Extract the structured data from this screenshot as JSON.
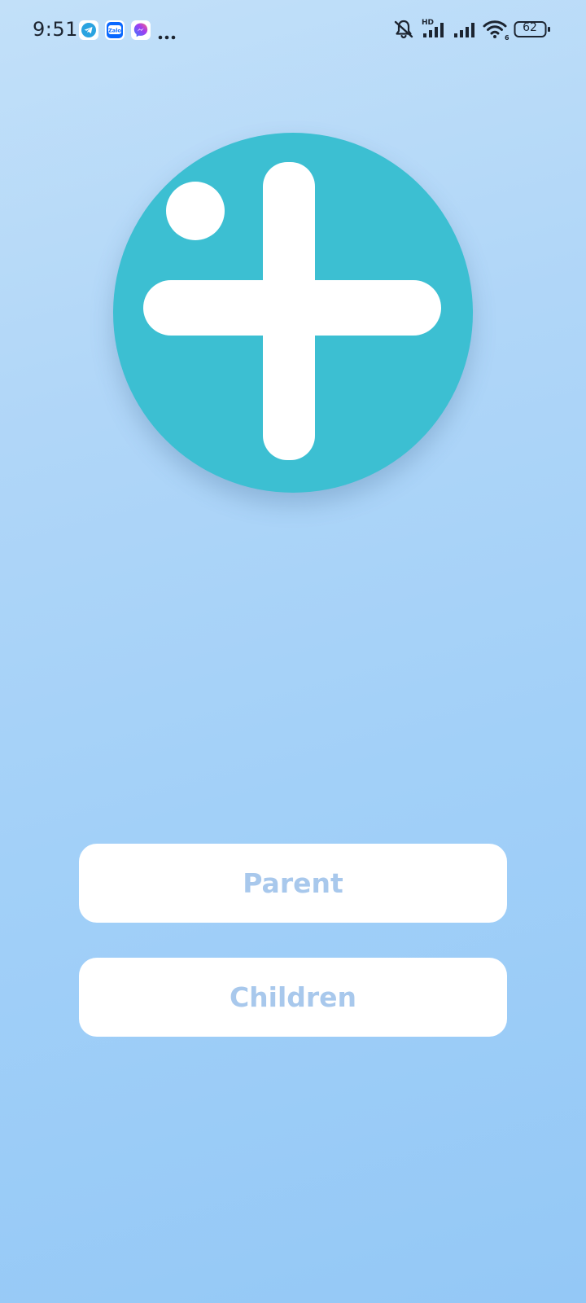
{
  "status_bar": {
    "time": "9:51",
    "notification_icons": [
      "telegram-icon",
      "zalo-icon",
      "messenger-icon",
      "more-dots-icon"
    ],
    "zalo_label": "Zalo",
    "network_label": "HD",
    "battery_level": "62",
    "right_icons": [
      "mute-icon",
      "signal-icon",
      "signal-icon",
      "wifi-icon",
      "battery-icon"
    ]
  },
  "logo": {
    "icon": "plus-logo-icon",
    "background_color": "#3cbfd2",
    "shape_color": "#ffffff"
  },
  "buttons": {
    "parent_label": "Parent",
    "children_label": "Children",
    "text_color": "#a8c8ec"
  },
  "colors": {
    "background_top": "#c2e0f9",
    "background_bottom": "#94c8f6"
  }
}
